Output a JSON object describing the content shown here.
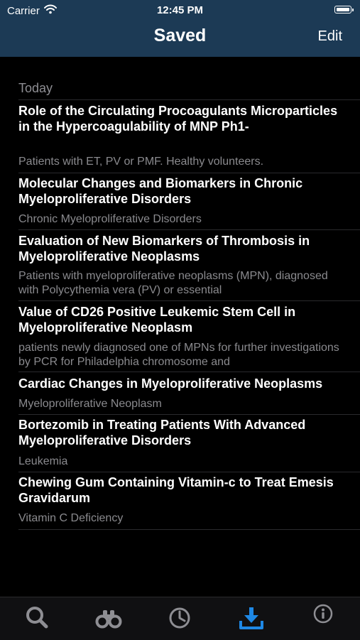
{
  "status_bar": {
    "carrier": "Carrier",
    "time": "12:45 PM"
  },
  "nav": {
    "title": "Saved",
    "edit_label": "Edit"
  },
  "section_header": "Today",
  "items": [
    {
      "title": "Role of the Circulating Procoagulants Microparticles in the Hypercoagulability of MNP Ph1-",
      "subtitle": "Patients with ET, PV or PMF. Healthy volunteers."
    },
    {
      "title": "Molecular Changes and Biomarkers in Chronic Myeloproliferative Disorders",
      "subtitle": "Chronic Myeloproliferative Disorders"
    },
    {
      "title": "Evaluation of New Biomarkers of Thrombosis in Myeloproliferative Neoplasms",
      "subtitle": "Patients with myeloproliferative neoplasms (MPN), diagnosed with Polycythemia vera (PV) or essential"
    },
    {
      "title": "Value of CD26 Positive Leukemic Stem Cell in Myeloproliferative Neoplasm",
      "subtitle": "patients newly diagnosed one of MPNs for further investigations by PCR for Philadelphia chromosome and"
    },
    {
      "title": "Cardiac Changes in Myeloproliferative Neoplasms",
      "subtitle": "Myeloproliferative Neoplasm"
    },
    {
      "title": "Bortezomib in Treating Patients With Advanced Myeloproliferative Disorders",
      "subtitle": "Leukemia"
    },
    {
      "title": "Chewing Gum Containing Vitamin-c to Treat Emesis Gravidarum",
      "subtitle": "Vitamin C Deficiency"
    }
  ],
  "tabs": [
    {
      "icon": "search-icon",
      "selected": false
    },
    {
      "icon": "binoculars-icon",
      "selected": false
    },
    {
      "icon": "clock-icon",
      "selected": false
    },
    {
      "icon": "download-icon",
      "selected": true
    },
    {
      "icon": "info-icon",
      "selected": false
    }
  ],
  "colors": {
    "header_bg": "#1c3a55",
    "background": "#000000",
    "accent": "#1e88e5",
    "tab_inactive": "#8e8e93",
    "subtitle": "#8a8a8e"
  }
}
